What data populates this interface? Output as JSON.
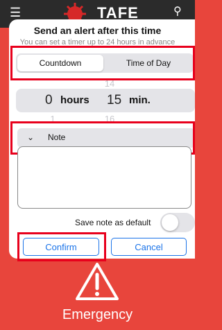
{
  "background": {
    "brand_text": "TAFE",
    "emergency_label": "Emergency"
  },
  "dialog": {
    "title": "Send an alert after this time",
    "subtitle": "You can set a timer up to 24 hours in advance",
    "segments": {
      "countdown": "Countdown",
      "time_of_day": "Time of Day",
      "selected": "Countdown"
    },
    "picker": {
      "hours_above": "",
      "minutes_above": "14",
      "hours_value": "0",
      "hours_unit": "hours",
      "minutes_value": "15",
      "minutes_unit": "min.",
      "hours_below": "1",
      "minutes_below": "16"
    },
    "note": {
      "label": "Note",
      "value": ""
    },
    "save_default_label": "Save note as default",
    "save_default_on": false,
    "buttons": {
      "confirm": "Confirm",
      "cancel": "Cancel"
    }
  },
  "colors": {
    "accent": "#1a73e8",
    "emergency": "#e8453c",
    "highlight": "#e8001c"
  }
}
